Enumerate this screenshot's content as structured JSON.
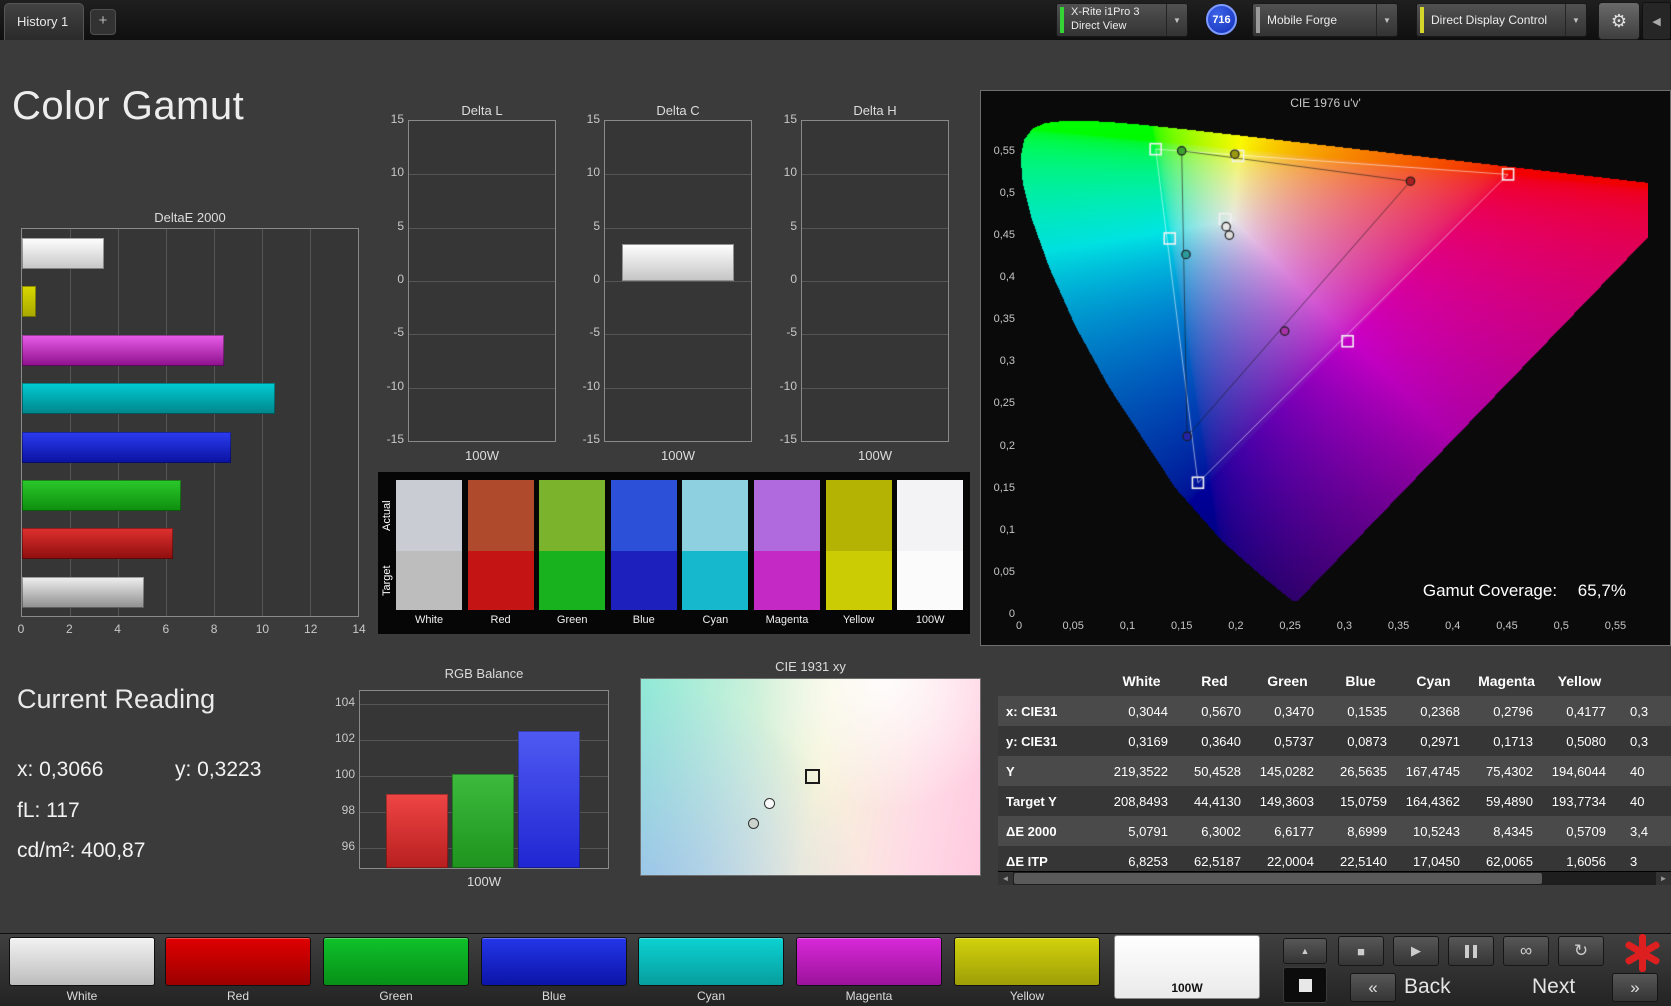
{
  "topbar": {
    "history_tab": "History 1",
    "add_tab": "+",
    "meter_line1": "X-Rite i1Pro 3",
    "meter_line2": "Direct View",
    "badge": "716",
    "pattern_source": "Mobile Forge",
    "display_control": "Direct Display Control"
  },
  "icons": {
    "chevron_down": "▼",
    "collapse": "◀",
    "gear": "⚙",
    "stop": "■",
    "play": "▶",
    "infinity": "∞",
    "refresh": "↻",
    "up": "▲",
    "scroll_left": "◄",
    "scroll_right": "►"
  },
  "page_title": "Color Gamut",
  "current_reading": {
    "title": "Current Reading",
    "x": "x: 0,3066",
    "y": "y: 0,3223",
    "fl": "fL: 117",
    "cd": "cd/m²: 400,87"
  },
  "swatch_strip": {
    "row_labels": [
      "Actual",
      "Target"
    ],
    "patches": [
      {
        "label": "White",
        "actual": "#c9cdd3",
        "target": "#bdbdbd"
      },
      {
        "label": "Red",
        "actual": "#b04a2c",
        "target": "#c51414"
      },
      {
        "label": "Green",
        "actual": "#7cb32c",
        "target": "#17b21e"
      },
      {
        "label": "Blue",
        "actual": "#2c50d8",
        "target": "#1d20bd"
      },
      {
        "label": "Cyan",
        "actual": "#8ecfe0",
        "target": "#15b8cd"
      },
      {
        "label": "Magenta",
        "actual": "#b06ade",
        "target": "#c529c5"
      },
      {
        "label": "Yellow",
        "actual": "#b4b303",
        "target": "#cbcc04"
      },
      {
        "label": "100W",
        "actual": "#f3f3f5",
        "target": "#fbfbfb"
      }
    ]
  },
  "table": {
    "headers": [
      "White",
      "Red",
      "Green",
      "Blue",
      "Cyan",
      "Magenta",
      "Yellow"
    ],
    "rows": [
      {
        "label": "x: CIE31",
        "values": [
          "0,3044",
          "0,5670",
          "0,3470",
          "0,1535",
          "0,2368",
          "0,2796",
          "0,4177"
        ],
        "partial": "0,3"
      },
      {
        "label": "y: CIE31",
        "values": [
          "0,3169",
          "0,3640",
          "0,5737",
          "0,0873",
          "0,2971",
          "0,1713",
          "0,5080"
        ],
        "partial": "0,3"
      },
      {
        "label": "Y",
        "values": [
          "219,3522",
          "50,4528",
          "145,0282",
          "26,5635",
          "167,4745",
          "75,4302",
          "194,6044"
        ],
        "partial": "40"
      },
      {
        "label": "Target Y",
        "values": [
          "208,8493",
          "44,4130",
          "149,3603",
          "15,0759",
          "164,4362",
          "59,4890",
          "193,7734"
        ],
        "partial": "40"
      },
      {
        "label": "ΔE 2000",
        "values": [
          "5,0791",
          "6,3002",
          "6,6177",
          "8,6999",
          "10,5243",
          "8,4345",
          "0,5709"
        ],
        "partial": "3,4"
      },
      {
        "label": "ΔE ITP",
        "values": [
          "6,8253",
          "62,5187",
          "22,0004",
          "22,5140",
          "17,0450",
          "62,0065",
          "1,6056"
        ],
        "partial": "3"
      }
    ]
  },
  "bottom_bar": {
    "patches": [
      {
        "label": "White",
        "c1": "#f2f2f2",
        "c2": "#bdbdbd"
      },
      {
        "label": "Red",
        "c1": "#e00000",
        "c2": "#9c0000"
      },
      {
        "label": "Green",
        "c1": "#0ec22a",
        "c2": "#089018"
      },
      {
        "label": "Blue",
        "c1": "#2336e8",
        "c2": "#0c14a8"
      },
      {
        "label": "Cyan",
        "c1": "#0cd2d2",
        "c2": "#089e9e"
      },
      {
        "label": "Magenta",
        "c1": "#d829d8",
        "c2": "#9c129c"
      },
      {
        "label": "Yellow",
        "c1": "#d2d20c",
        "c2": "#9e9e08"
      },
      {
        "label": "100W",
        "selected": true
      }
    ],
    "back_label": "Back",
    "next_label": "Next",
    "prev_icon": "«",
    "next_icon": "»"
  },
  "chart_data": [
    {
      "id": "delta_e_2000",
      "type": "bar",
      "orientation": "horizontal",
      "title": "DeltaE 2000",
      "categories": [
        "100W",
        "Yellow",
        "Magenta",
        "Cyan",
        "Blue",
        "Green",
        "Red",
        "White"
      ],
      "values": [
        3.4,
        0.5709,
        8.4345,
        10.5243,
        8.6999,
        6.6177,
        6.3002,
        5.0791
      ],
      "bar_colors": [
        [
          "#ffffff",
          "#c6c6c6"
        ],
        [
          "#d9d900",
          "#a8a800"
        ],
        [
          "#e95ce9",
          "#8d108d"
        ],
        [
          "#00ccd3",
          "#00858b"
        ],
        [
          "#2b3cf0",
          "#0a12a0"
        ],
        [
          "#2bc92b",
          "#0e8e0e"
        ],
        [
          "#e03030",
          "#8e0e0e"
        ],
        [
          "#f0f0f0",
          "#8e8e8e"
        ]
      ],
      "xlim": [
        0,
        14
      ],
      "xticks": [
        0,
        2,
        4,
        6,
        8,
        10,
        12,
        14
      ]
    },
    {
      "id": "delta_l",
      "type": "bar",
      "title": "Delta L",
      "categories": [
        "100W"
      ],
      "values": [
        0
      ],
      "ylim": [
        -15,
        15
      ],
      "yticks": [
        15,
        10,
        5,
        0,
        -5,
        -10,
        -15
      ],
      "xlabel": "100W"
    },
    {
      "id": "delta_c",
      "type": "bar",
      "title": "Delta C",
      "categories": [
        "100W"
      ],
      "values": [
        3.5
      ],
      "ylim": [
        -15,
        15
      ],
      "yticks": [
        15,
        10,
        5,
        0,
        -5,
        -10,
        -15
      ],
      "xlabel": "100W"
    },
    {
      "id": "delta_h",
      "type": "bar",
      "title": "Delta H",
      "categories": [
        "100W"
      ],
      "values": [
        0
      ],
      "ylim": [
        -15,
        15
      ],
      "yticks": [
        15,
        10,
        5,
        0,
        -5,
        -10,
        -15
      ],
      "xlabel": "100W"
    },
    {
      "id": "cie1976",
      "type": "scatter",
      "title": "CIE 1976 u'v'",
      "xlim": [
        0,
        0.58
      ],
      "ylim": [
        0,
        0.59
      ],
      "tick_step": 0.05,
      "xtick_labels": [
        "0",
        "0,05",
        "0,1",
        "0,15",
        "0,2",
        "0,25",
        "0,3",
        "0,35",
        "0,4",
        "0,45",
        "0,5",
        "0,55"
      ],
      "ytick_labels": [
        "0",
        "0,05",
        "0,1",
        "0,15",
        "0,2",
        "0,25",
        "0,3",
        "0,35",
        "0,4",
        "0,45",
        "0,5",
        "0,55"
      ],
      "gamut_coverage_label": "Gamut Coverage:",
      "gamut_coverage_value": "65,7%",
      "targets": [
        {
          "name": "green",
          "u": 0.126,
          "v": 0.553
        },
        {
          "name": "yellow",
          "u": 0.202,
          "v": 0.545
        },
        {
          "name": "red",
          "u": 0.451,
          "v": 0.523
        },
        {
          "name": "white",
          "u": 0.19,
          "v": 0.47
        },
        {
          "name": "cyan",
          "u": 0.139,
          "v": 0.447
        },
        {
          "name": "magenta",
          "u": 0.303,
          "v": 0.325
        },
        {
          "name": "blue",
          "u": 0.165,
          "v": 0.157
        }
      ],
      "measured": [
        {
          "name": "green",
          "u": 0.15,
          "v": 0.551,
          "fill": "#3da32f"
        },
        {
          "name": "yellow",
          "u": 0.199,
          "v": 0.547,
          "fill": "#9a9a12"
        },
        {
          "name": "red",
          "u": 0.361,
          "v": 0.515,
          "fill": "#a82020"
        },
        {
          "name": "white",
          "u": 0.191,
          "v": 0.461,
          "fill": "#e6e6e6"
        },
        {
          "name": "white",
          "u": 0.194,
          "v": 0.451,
          "fill": "#dcdcdc"
        },
        {
          "name": "cyan",
          "u": 0.154,
          "v": 0.428,
          "fill": "#2c9a9a"
        },
        {
          "name": "magenta",
          "u": 0.245,
          "v": 0.337,
          "fill": "#a833a8"
        },
        {
          "name": "blue",
          "u": 0.155,
          "v": 0.212,
          "fill": "#2323a8"
        }
      ]
    },
    {
      "id": "rgb_balance",
      "type": "bar",
      "title": "RGB Balance",
      "categories": [
        "Red",
        "Green",
        "Blue"
      ],
      "values": [
        99.0,
        100.1,
        102.5
      ],
      "bar_colors": [
        [
          "#ef4545",
          "#b81f1f"
        ],
        [
          "#3dbb3d",
          "#1e941e"
        ],
        [
          "#4f5af2",
          "#2026d2"
        ]
      ],
      "yticks": [
        104,
        102,
        100,
        98,
        96
      ],
      "xlabel": "100W"
    },
    {
      "id": "cie1931",
      "type": "scatter",
      "title": "CIE 1931 xy",
      "points": [
        {
          "name": "target",
          "marker": "square",
          "fx": 0.5,
          "fy": 0.49
        },
        {
          "name": "measured",
          "marker": "circle",
          "fx": 0.378,
          "fy": 0.63,
          "fill": "#fafafa"
        },
        {
          "name": "measured",
          "marker": "circle",
          "fx": 0.331,
          "fy": 0.73,
          "fill": "#ccd2cc"
        }
      ]
    }
  ]
}
